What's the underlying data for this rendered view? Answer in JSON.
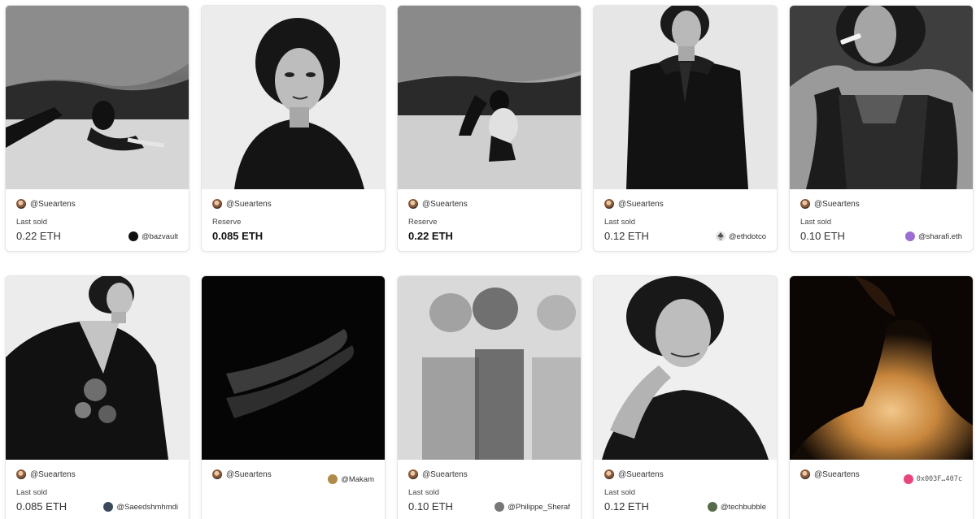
{
  "cards": [
    {
      "creator": "@Sueartens",
      "status": "Last sold",
      "price": "0.22 ETH",
      "owner": "@bazvault",
      "owner_avatar_color": "#111111",
      "art_icon": "cave-figure-photo"
    },
    {
      "creator": "@Sueartens",
      "status": "Reserve",
      "price": "0.085 ETH",
      "owner": "",
      "owner_avatar_color": "",
      "art_icon": "portrait-photo"
    },
    {
      "creator": "@Sueartens",
      "status": "Reserve",
      "price": "0.22 ETH",
      "owner": "",
      "owner_avatar_color": "",
      "art_icon": "cave-seated-photo"
    },
    {
      "creator": "@Sueartens",
      "status": "Last sold",
      "price": "0.12 ETH",
      "owner": "@ethdotco",
      "owner_avatar_color": "#dddddd",
      "art_icon": "standing-portrait-photo"
    },
    {
      "creator": "@Sueartens",
      "status": "Last sold",
      "price": "0.10 ETH",
      "owner": "@sharafi.eth",
      "owner_avatar_color": "#9b6fd1",
      "art_icon": "smoking-portrait-photo"
    },
    {
      "creator": "@Sueartens",
      "status": "Last sold",
      "price": "0.085 ETH",
      "owner": "@Saeedshmhmdi",
      "owner_avatar_color": "#3a4a5a",
      "art_icon": "seated-dark-dress-photo"
    },
    {
      "creator": "@Sueartens",
      "status": "",
      "price": "",
      "owner": "@Makam",
      "owner_avatar_color": "#b08a4a",
      "art_icon": "legs-photo"
    },
    {
      "creator": "@Sueartens",
      "status": "Last sold",
      "price": "0.10 ETH",
      "owner": "@Philippe_Sheraf",
      "owner_avatar_color": "#777777",
      "art_icon": "multiple-exposure-photo"
    },
    {
      "creator": "@Sueartens",
      "status": "Last sold",
      "price": "0.12 ETH",
      "owner": "@techbubble",
      "owner_avatar_color": "#556b4a",
      "art_icon": "smiling-portrait-photo"
    },
    {
      "creator": "@Sueartens",
      "status": "",
      "price": "",
      "owner": "0x003F…407c",
      "owner_avatar_color": "#e8457f",
      "art_icon": "neck-light-photo"
    }
  ]
}
